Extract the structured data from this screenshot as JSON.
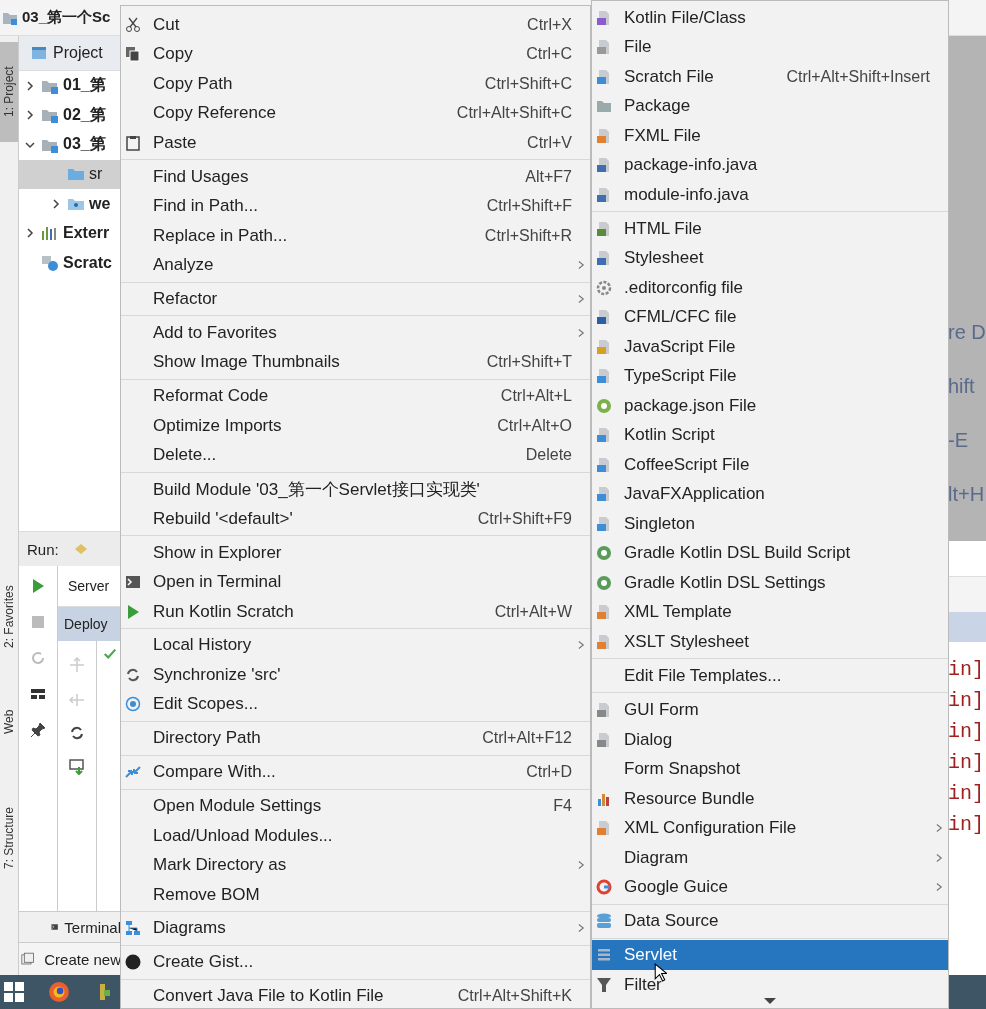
{
  "title_bar": {
    "project_name": "03_第一个Sc"
  },
  "tool_window_stripe": [
    {
      "label": "1: Project",
      "selected": true
    },
    {
      "label": "2: Favorites",
      "selected": false
    },
    {
      "label": "Web",
      "selected": false
    },
    {
      "label": "7: Structure",
      "selected": false
    }
  ],
  "project_panel": {
    "title": "Project",
    "tree": [
      {
        "label": "01_第",
        "kind": "module",
        "expanded": false,
        "selected": false
      },
      {
        "label": "02_第",
        "kind": "module",
        "expanded": false,
        "selected": false
      },
      {
        "label": "03_第",
        "kind": "module",
        "expanded": true,
        "selected": false,
        "children": [
          {
            "label": "sr",
            "kind": "folder",
            "selected": true
          },
          {
            "label": "we",
            "kind": "web",
            "expanded": false,
            "selected": false
          }
        ]
      },
      {
        "label": "Exterr",
        "kind": "libraries",
        "expanded": false,
        "selected": false
      },
      {
        "label": "Scratc",
        "kind": "scratches",
        "selected": false
      }
    ]
  },
  "run_panel": {
    "title": "Run:",
    "tab": "Server",
    "column_header": "Deploy"
  },
  "terminal_tab": "Terminal",
  "status_text": "Create new",
  "editor_fragments": {
    "shortcut_hints": [
      "re D",
      "hift",
      "-E",
      "lt+H"
    ],
    "console_lines": [
      "in]",
      "in]",
      "in]",
      "in]",
      "in]",
      "in]"
    ]
  },
  "context_menu": {
    "groups": [
      [
        {
          "label": "Cut",
          "shortcut": "Ctrl+X",
          "submenu": false
        },
        {
          "label": "Copy",
          "shortcut": "Ctrl+C",
          "submenu": false
        },
        {
          "label": "Copy Path",
          "shortcut": "Ctrl+Shift+C",
          "submenu": false
        },
        {
          "label": "Copy Reference",
          "shortcut": "Ctrl+Alt+Shift+C",
          "submenu": false
        },
        {
          "label": "Paste",
          "shortcut": "Ctrl+V",
          "submenu": false
        }
      ],
      [
        {
          "label": "Find Usages",
          "shortcut": "Alt+F7",
          "submenu": false
        },
        {
          "label": "Find in Path...",
          "shortcut": "Ctrl+Shift+F",
          "submenu": false
        },
        {
          "label": "Replace in Path...",
          "shortcut": "Ctrl+Shift+R",
          "submenu": false
        },
        {
          "label": "Analyze",
          "submenu": true
        }
      ],
      [
        {
          "label": "Refactor",
          "submenu": true
        }
      ],
      [
        {
          "label": "Add to Favorites",
          "submenu": true
        },
        {
          "label": "Show Image Thumbnails",
          "shortcut": "Ctrl+Shift+T",
          "submenu": false
        }
      ],
      [
        {
          "label": "Reformat Code",
          "shortcut": "Ctrl+Alt+L",
          "submenu": false
        },
        {
          "label": "Optimize Imports",
          "shortcut": "Ctrl+Alt+O",
          "submenu": false
        },
        {
          "label": "Delete...",
          "shortcut": "Delete",
          "submenu": false
        }
      ],
      [
        {
          "label": "Build Module '03_第一个Servlet接口实现类'",
          "submenu": false
        },
        {
          "label": "Rebuild '<default>'",
          "shortcut": "Ctrl+Shift+F9",
          "submenu": false
        }
      ],
      [
        {
          "label": "Show in Explorer",
          "submenu": false
        },
        {
          "label": "Open in Terminal",
          "submenu": false
        },
        {
          "label": "Run Kotlin Scratch",
          "shortcut": "Ctrl+Alt+W",
          "submenu": false
        }
      ],
      [
        {
          "label": "Local History",
          "submenu": true
        },
        {
          "label": "Synchronize 'src'",
          "submenu": false
        },
        {
          "label": "Edit Scopes...",
          "submenu": false
        }
      ],
      [
        {
          "label": "Directory Path",
          "shortcut": "Ctrl+Alt+F12",
          "submenu": false
        }
      ],
      [
        {
          "label": "Compare With...",
          "shortcut": "Ctrl+D",
          "submenu": false
        }
      ],
      [
        {
          "label": "Open Module Settings",
          "shortcut": "F4",
          "submenu": false
        },
        {
          "label": "Load/Unload Modules...",
          "submenu": false
        },
        {
          "label": "Mark Directory as",
          "submenu": true
        },
        {
          "label": "Remove BOM",
          "submenu": false
        }
      ],
      [
        {
          "label": "Diagrams",
          "submenu": true
        }
      ],
      [
        {
          "label": "Create Gist...",
          "submenu": false
        }
      ],
      [
        {
          "label": "Convert Java File to Kotlin File",
          "shortcut": "Ctrl+Alt+Shift+K",
          "submenu": false
        }
      ]
    ]
  },
  "new_submenu": {
    "groups": [
      [
        {
          "label": "Kotlin File/Class",
          "submenu": false,
          "selected": false
        },
        {
          "label": "File",
          "submenu": false,
          "selected": false
        },
        {
          "label": "Scratch File",
          "shortcut": "Ctrl+Alt+Shift+Insert",
          "submenu": false,
          "selected": false
        },
        {
          "label": "Package",
          "submenu": false,
          "selected": false
        },
        {
          "label": "FXML File",
          "submenu": false,
          "selected": false
        },
        {
          "label": "package-info.java",
          "submenu": false,
          "selected": false
        },
        {
          "label": "module-info.java",
          "submenu": false,
          "selected": false
        }
      ],
      [
        {
          "label": "HTML File",
          "submenu": false,
          "selected": false
        },
        {
          "label": "Stylesheet",
          "submenu": false,
          "selected": false
        },
        {
          "label": ".editorconfig file",
          "submenu": false,
          "selected": false
        },
        {
          "label": "CFML/CFC file",
          "submenu": false,
          "selected": false
        },
        {
          "label": "JavaScript File",
          "submenu": false,
          "selected": false
        },
        {
          "label": "TypeScript File",
          "submenu": false,
          "selected": false
        },
        {
          "label": "package.json File",
          "submenu": false,
          "selected": false
        },
        {
          "label": "Kotlin Script",
          "submenu": false,
          "selected": false
        },
        {
          "label": "CoffeeScript File",
          "submenu": false,
          "selected": false
        },
        {
          "label": "JavaFXApplication",
          "submenu": false,
          "selected": false
        },
        {
          "label": "Singleton",
          "submenu": false,
          "selected": false
        },
        {
          "label": "Gradle Kotlin DSL Build Script",
          "submenu": false,
          "selected": false
        },
        {
          "label": "Gradle Kotlin DSL Settings",
          "submenu": false,
          "selected": false
        },
        {
          "label": "XML Template",
          "submenu": false,
          "selected": false
        },
        {
          "label": "XSLT Stylesheet",
          "submenu": false,
          "selected": false
        }
      ],
      [
        {
          "label": "Edit File Templates...",
          "submenu": false,
          "selected": false
        }
      ],
      [
        {
          "label": "GUI Form",
          "submenu": false,
          "selected": false
        },
        {
          "label": "Dialog",
          "submenu": false,
          "selected": false
        },
        {
          "label": "Form Snapshot",
          "submenu": false,
          "selected": false
        },
        {
          "label": "Resource Bundle",
          "submenu": false,
          "selected": false
        },
        {
          "label": "XML Configuration File",
          "submenu": true,
          "selected": false
        },
        {
          "label": "Diagram",
          "submenu": true,
          "selected": false
        },
        {
          "label": "Google Guice",
          "submenu": true,
          "selected": false
        }
      ],
      [
        {
          "label": "Data Source",
          "submenu": false,
          "selected": false
        }
      ],
      [
        {
          "label": "Servlet",
          "submenu": false,
          "selected": true
        },
        {
          "label": "Filter",
          "submenu": false,
          "selected": false
        }
      ]
    ]
  }
}
